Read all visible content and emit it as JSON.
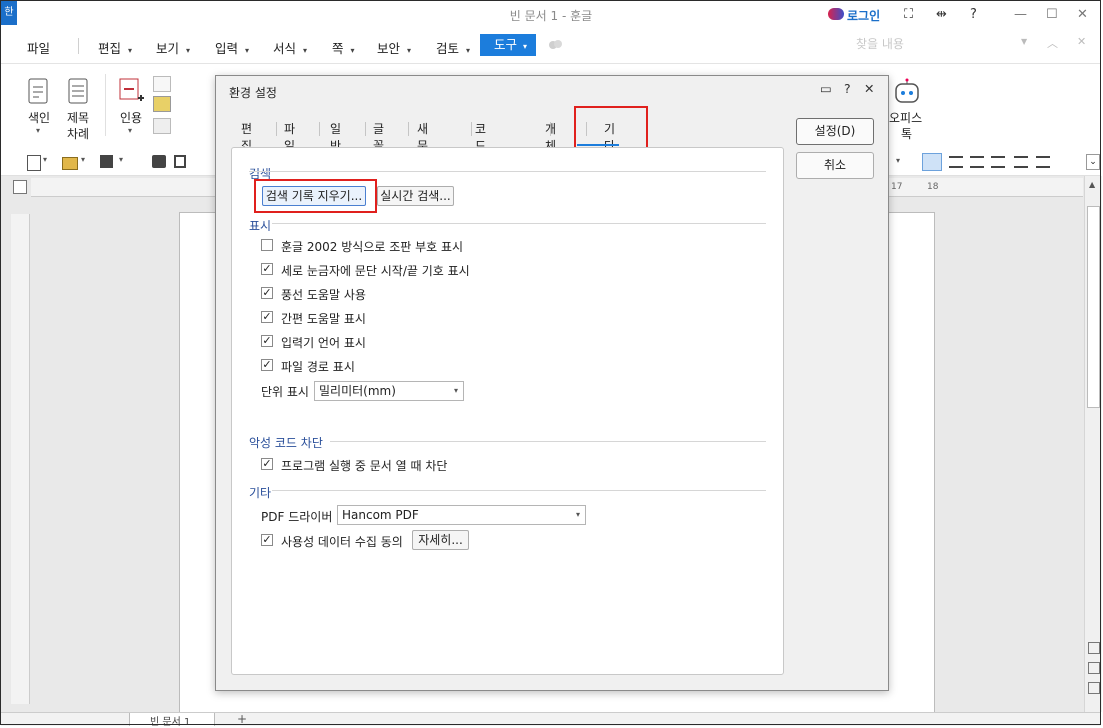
{
  "window": {
    "app_logo": "한",
    "title": "빈 문서 1 - 훈글",
    "login_label": "로그인",
    "controls": {
      "fullscreen": "⛶",
      "split": "⇹",
      "help": "?",
      "minimize": "—",
      "maximize": "☐",
      "close": "✕"
    }
  },
  "menubar": {
    "items": [
      {
        "label": "파일",
        "arrow": ""
      },
      {
        "label": "편집",
        "arrow": "▾"
      },
      {
        "label": "보기",
        "arrow": "▾"
      },
      {
        "label": "입력",
        "arrow": "▾"
      },
      {
        "label": "서식",
        "arrow": "▾"
      },
      {
        "label": "쪽",
        "arrow": "▾"
      },
      {
        "label": "보안",
        "arrow": "▾"
      },
      {
        "label": "검토",
        "arrow": "▾"
      }
    ],
    "active": {
      "label": "도구",
      "arrow": "▾"
    },
    "search_placeholder": "찾을 내용"
  },
  "ribbon": {
    "index_label": "색인",
    "toc_label_1": "제목",
    "toc_label_2": "차례",
    "cite_label": "인용",
    "office_label_1": "오피스",
    "office_label_2": "톡"
  },
  "ruler": {
    "mark_17": "17",
    "mark_18": "18"
  },
  "statusbar": {
    "doc_tab": "빈 문서 1",
    "add_tab": "+"
  },
  "dialog": {
    "title": "환경 설정",
    "controls": {
      "option": "▭",
      "help": "?",
      "close": "✕"
    },
    "tabs": [
      "편집",
      "파일",
      "일반",
      "글꼴",
      "새 문서",
      "코드 형식",
      "개체",
      "기타"
    ],
    "active_tab": "기타",
    "ok_button": "설정(D)",
    "cancel_button": "취소",
    "search": {
      "title": "검색",
      "clear_history_button": "검색 기록 지우기...",
      "realtime_button": "실시간 검색..."
    },
    "display": {
      "title": "표시",
      "options": [
        {
          "label": "훈글 2002 방식으로 조판 부호 표시",
          "checked": false,
          "mark": ""
        },
        {
          "label": "세로 눈금자에 문단 시작/끝 기호 표시",
          "checked": true,
          "mark": "✓"
        },
        {
          "label": "풍선 도움말 사용",
          "checked": true,
          "mark": "✓"
        },
        {
          "label": "간편 도움말 표시",
          "checked": true,
          "mark": "✓"
        },
        {
          "label": "입력기 언어 표시",
          "checked": true,
          "mark": "✓"
        },
        {
          "label": "파일 경로 표시",
          "checked": true,
          "mark": "✓"
        }
      ],
      "unit_label": "단위 표시",
      "unit_value": "밀리미터(mm)"
    },
    "malware": {
      "title": "악성 코드 차단",
      "option": {
        "label": "프로그램 실행 중 문서 열 때 차단",
        "checked": true,
        "mark": "✓"
      }
    },
    "etc": {
      "title": "기타",
      "pdf_label": "PDF 드라이버",
      "pdf_value": "Hancom PDF",
      "usage": {
        "label": "사용성 데이터 수집 동의",
        "checked": true,
        "mark": "✓"
      },
      "details_button": "자세히..."
    }
  },
  "colors": {
    "accent": "#1c7ddc",
    "highlight_box": "#e0201d",
    "section_title": "#2a4f9a"
  }
}
